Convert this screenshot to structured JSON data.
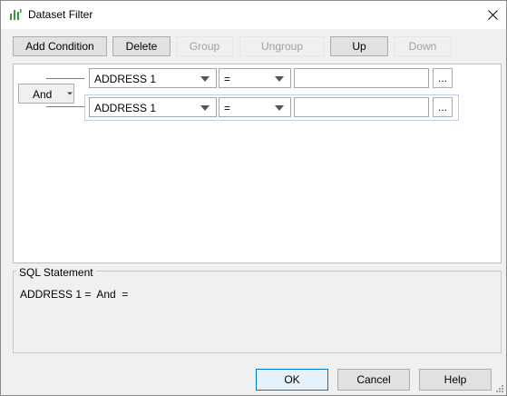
{
  "window": {
    "title": "Dataset Filter",
    "app_icon": "chart-bars-icon",
    "close_icon": "close-icon"
  },
  "toolbar": {
    "add_condition": "Add Condition",
    "delete": "Delete",
    "group": "Group",
    "ungroup": "Ungroup",
    "up": "Up",
    "down": "Down"
  },
  "conditions": {
    "logic_operator": "And",
    "rows": [
      {
        "field": "ADDRESS 1",
        "operator": "=",
        "value": "",
        "ellipsis": "..."
      },
      {
        "field": "ADDRESS 1",
        "operator": "=",
        "value": "",
        "ellipsis": "..."
      }
    ]
  },
  "sql": {
    "legend": "SQL Statement",
    "statement": "ADDRESS 1 =  And  ="
  },
  "footer": {
    "ok": "OK",
    "cancel": "Cancel",
    "help": "Help"
  },
  "colors": {
    "default_button_border": "#0078d7",
    "icon_green": "#3a9a3a"
  }
}
